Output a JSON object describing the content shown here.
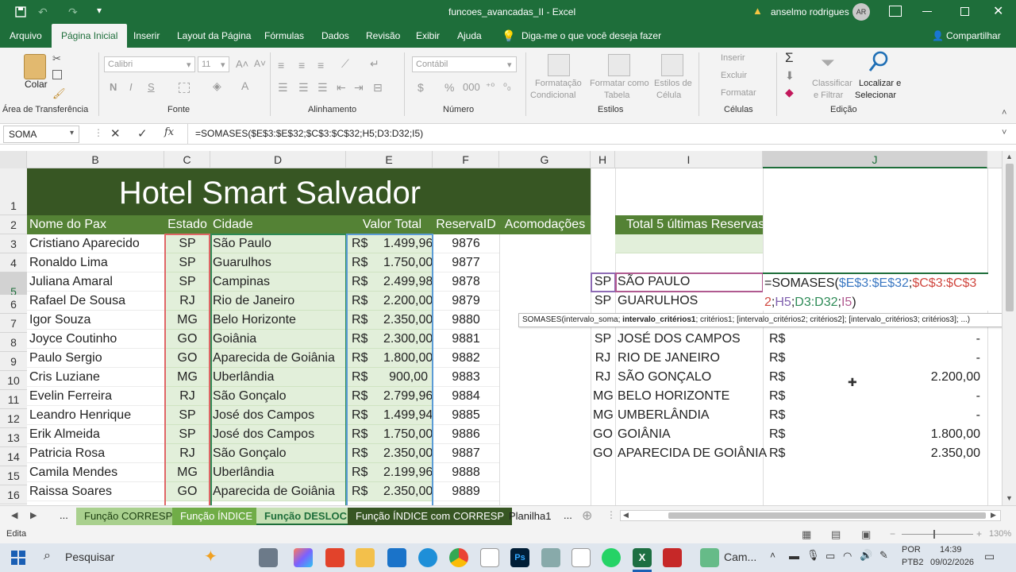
{
  "title": {
    "filename": "funcoes_avancadas_II",
    "separator": "-",
    "app": "Excel",
    "user": "anselmo rodrigues",
    "avatar": "AR"
  },
  "tabs": [
    "Arquivo",
    "Página Inicial",
    "Inserir",
    "Layout da Página",
    "Fórmulas",
    "Dados",
    "Revisão",
    "Exibir",
    "Ajuda"
  ],
  "tell_me": "Diga-me o que você deseja fazer",
  "share": "Compartilhar",
  "ribbon": {
    "paste": "Colar",
    "clipboard": "Área de Transferência",
    "font_name": "Calibri",
    "font_size": "11",
    "font_group": "Fonte",
    "align_group": "Alinhamento",
    "number_format": "Contábil",
    "number_group": "Número",
    "cond_format": [
      "Formatação",
      "Condicional"
    ],
    "format_table": [
      "Formatar como",
      "Tabela"
    ],
    "cell_styles": [
      "Estilos de",
      "Célula"
    ],
    "styles_group": "Estilos",
    "insert": "Inserir",
    "delete": "Excluir",
    "format": "Formatar",
    "cells_group": "Células",
    "sort": [
      "Classificar",
      "e Filtrar"
    ],
    "find": [
      "Localizar e",
      "Selecionar"
    ],
    "edit_group": "Edição"
  },
  "formula_bar": {
    "name_box": "SOMA",
    "fx": "fx",
    "formula": "=SOMASES($E$3:$E$32;$C$3:$C$32;H5;D3:D32;I5)"
  },
  "columns": [
    "B",
    "C",
    "D",
    "E",
    "F",
    "G",
    "H",
    "I",
    "J"
  ],
  "rows": [
    "1",
    "2",
    "3",
    "4",
    "5",
    "6",
    "7",
    "8",
    "9",
    "10",
    "11",
    "12",
    "13",
    "14",
    "15",
    "16"
  ],
  "banner": "Hotel Smart Salvador",
  "headers": {
    "b": "Nome do Pax",
    "c": "Estado",
    "d": "Cidade",
    "e": "Valor Total",
    "f": "ReservaID",
    "g": "Acomodações",
    "i": "Total 5 últimas Reservas"
  },
  "table": [
    {
      "name": "Cristiano Aparecido",
      "uf": "SP",
      "city": "São Paulo",
      "rs": "R$",
      "value": "1.499,96",
      "id": "9876"
    },
    {
      "name": "Ronaldo Lima",
      "uf": "SP",
      "city": "Guarulhos",
      "rs": "R$",
      "value": "1.750,00",
      "id": "9877"
    },
    {
      "name": "Juliana Amaral",
      "uf": "SP",
      "city": "Campinas",
      "rs": "R$",
      "value": "2.499,98",
      "id": "9878"
    },
    {
      "name": "Rafael De Sousa",
      "uf": "RJ",
      "city": "Rio de Janeiro",
      "rs": "R$",
      "value": "2.200,00",
      "id": "9879"
    },
    {
      "name": "Igor Souza",
      "uf": "MG",
      "city": "Belo Horizonte",
      "rs": "R$",
      "value": "2.350,00",
      "id": "9880"
    },
    {
      "name": "Joyce Coutinho",
      "uf": "GO",
      "city": "Goiânia",
      "rs": "R$",
      "value": "2.300,00",
      "id": "9881"
    },
    {
      "name": "Paulo Sergio",
      "uf": "GO",
      "city": "Aparecida de Goiânia",
      "rs": "R$",
      "value": "1.800,00",
      "id": "9882"
    },
    {
      "name": "Cris Luziane",
      "uf": "MG",
      "city": "Uberlândia",
      "rs": "R$",
      "value": "900,00",
      "id": "9883"
    },
    {
      "name": "Evelin Ferreira",
      "uf": "RJ",
      "city": "São Gonçalo",
      "rs": "R$",
      "value": "2.799,96",
      "id": "9884"
    },
    {
      "name": "Leandro Henrique",
      "uf": "SP",
      "city": "José dos Campos",
      "rs": "R$",
      "value": "1.499,94",
      "id": "9885"
    },
    {
      "name": "Erik Almeida",
      "uf": "SP",
      "city": "José dos Campos",
      "rs": "R$",
      "value": "1.750,00",
      "id": "9886"
    },
    {
      "name": "Patricia Rosa",
      "uf": "RJ",
      "city": "São Gonçalo",
      "rs": "R$",
      "value": "2.350,00",
      "id": "9887"
    },
    {
      "name": "Camila Mendes",
      "uf": "MG",
      "city": "Uberlândia",
      "rs": "R$",
      "value": "2.199,96",
      "id": "9888"
    },
    {
      "name": "Raissa Soares",
      "uf": "GO",
      "city": "Aparecida de Goiânia",
      "rs": "R$",
      "value": "2.350,00",
      "id": "9889"
    }
  ],
  "side": [
    {
      "uf": "SP",
      "city": "SÃO PAULO",
      "rs": "",
      "value": ""
    },
    {
      "uf": "SP",
      "city": "GUARULHOS",
      "rs": "",
      "value": ""
    },
    {
      "uf": "",
      "city": "",
      "rs": "",
      "value": ""
    },
    {
      "uf": "SP",
      "city": "JOSÉ DOS CAMPOS",
      "rs": "R$",
      "value": "-"
    },
    {
      "uf": "RJ",
      "city": "RIO DE JANEIRO",
      "rs": "R$",
      "value": "-"
    },
    {
      "uf": "RJ",
      "city": "SÃO GONÇALO",
      "rs": "R$",
      "value": "2.200,00"
    },
    {
      "uf": "MG",
      "city": "BELO HORIZONTE",
      "rs": "R$",
      "value": "-"
    },
    {
      "uf": "MG",
      "city": "UMBERLÂNDIA",
      "rs": "R$",
      "value": "-"
    },
    {
      "uf": "GO",
      "city": "GOIÂNIA",
      "rs": "R$",
      "value": "1.800,00"
    },
    {
      "uf": "GO",
      "city": "APARECIDA DE GOIÂNIA",
      "rs": "R$",
      "value": "2.350,00"
    }
  ],
  "edit_formula": {
    "p1": "=SOMASES(",
    "a1": "$E$3:$E$32",
    "s1": ";",
    "a2": "$C$3:$C$32",
    "s2": ";",
    "a3": "H5",
    "s3": ";",
    "a4": "D3:D32",
    "s4": ";",
    "a5": "I5",
    "p2": ")"
  },
  "tooltip": {
    "pre": "SOMASES(intervalo_soma; ",
    "bold": "intervalo_critérios1",
    "post": "; critérios1; [intervalo_critérios2; critérios2]; [intervalo_critérios3; critérios3]; ...)"
  },
  "sheets": {
    "more_left": "...",
    "tabs": [
      "Função CORRESP",
      "Função ÍNDICE",
      "Função DESLOC",
      "Função ÍNDICE com CORRESP",
      "Planilha1"
    ],
    "more_right": "..."
  },
  "status": {
    "mode": "Edita",
    "zoom": "130%"
  },
  "taskbar": {
    "search": "Pesquisar",
    "app_label": "Cam...",
    "lang1": "POR",
    "lang2": "PTB2",
    "time": "14:39",
    "date": "09/02/2026"
  }
}
